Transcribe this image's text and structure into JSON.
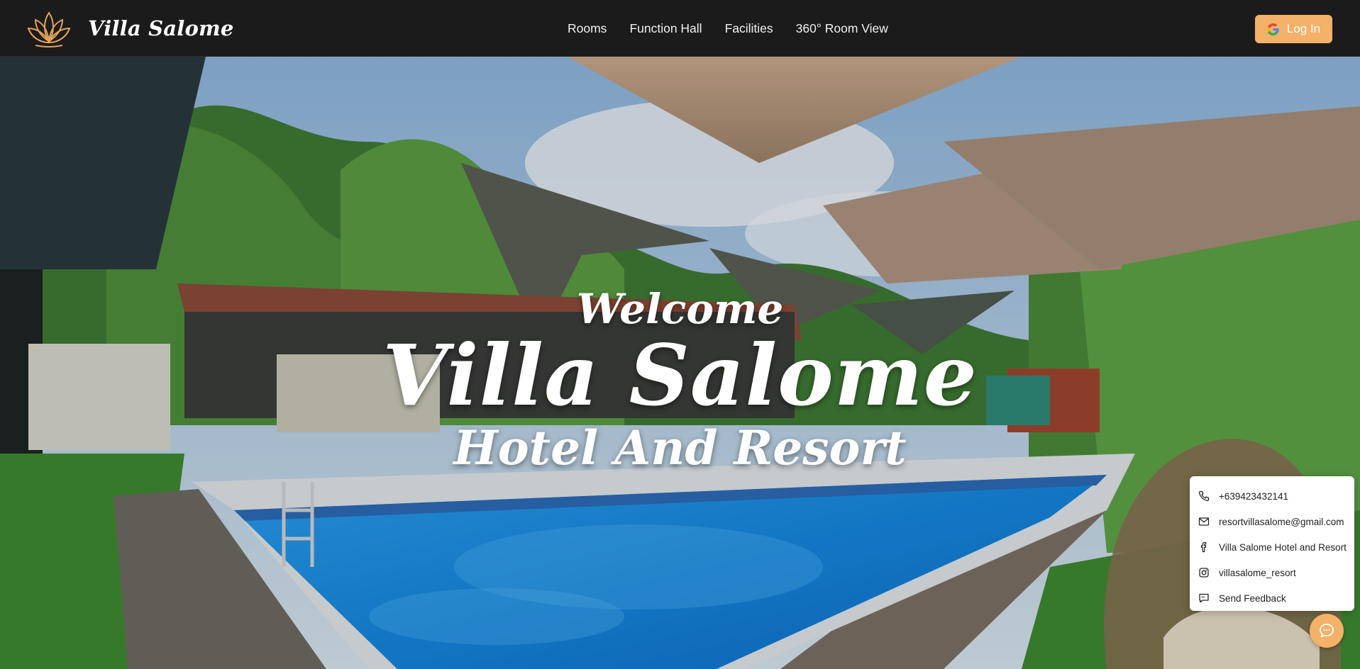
{
  "brand": {
    "name": "Villa Salome",
    "logo_icon": "lotus-icon"
  },
  "nav": {
    "links": [
      "Rooms",
      "Function Hall",
      "Facilities",
      "360° Room View"
    ]
  },
  "login": {
    "label": "Log In",
    "icon": "google-icon"
  },
  "hero": {
    "welcome": "Welcome",
    "title": "Villa Salome",
    "subtitle": "Hotel And Resort"
  },
  "contact": {
    "items": [
      {
        "icon": "phone-icon",
        "text": "+639423432141"
      },
      {
        "icon": "mail-icon",
        "text": "resortvillasalome@gmail.com"
      },
      {
        "icon": "facebook-icon",
        "text": "Villa Salome Hotel and Resort"
      },
      {
        "icon": "instagram-icon",
        "text": "villasalome_resort"
      },
      {
        "icon": "feedback-icon",
        "text": "Send Feedback"
      }
    ]
  },
  "chat": {
    "icon": "chat-icon"
  },
  "colors": {
    "accent": "#f4b168",
    "navbar": "#1b1b1b",
    "pool": "#1e8fe0"
  }
}
